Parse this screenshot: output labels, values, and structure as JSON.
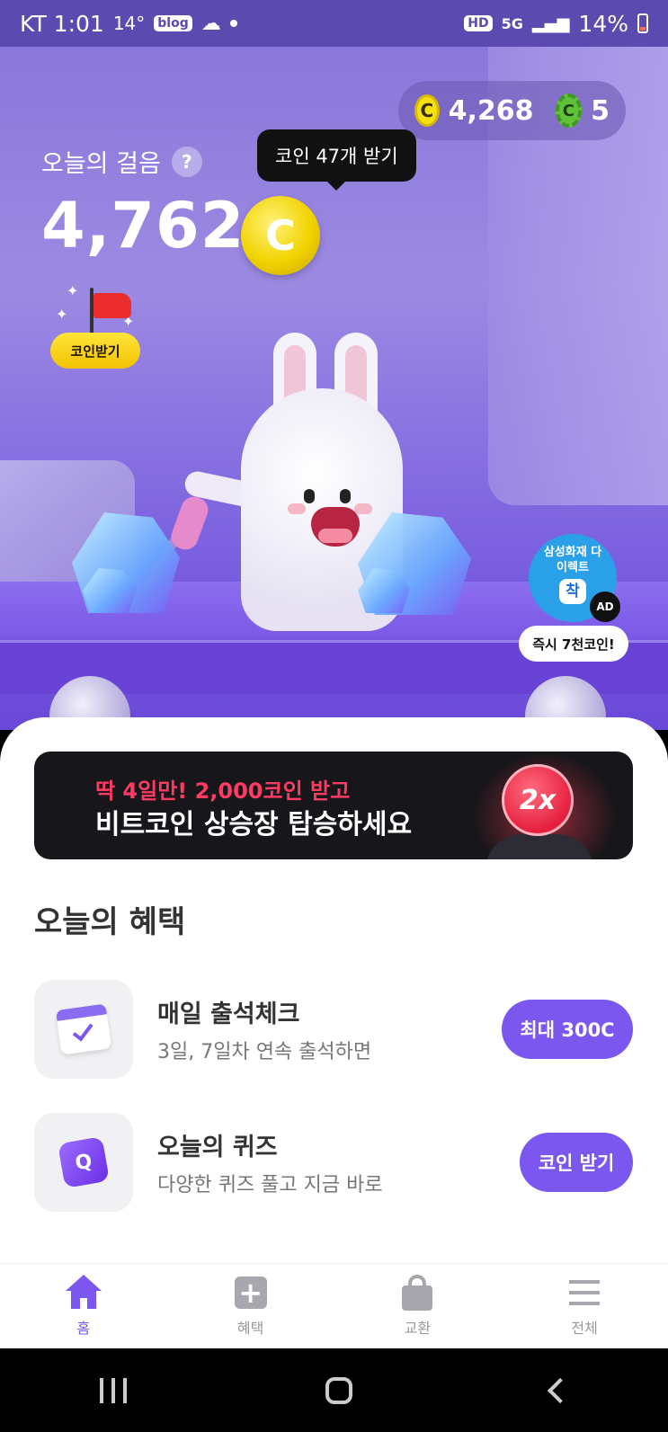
{
  "status_bar": {
    "carrier_time": "KT 1:01",
    "temp": "14°",
    "blog_badge": "blog",
    "hd": "HD",
    "net": "5G",
    "battery": "14%",
    "icons": [
      "blog-icon",
      "cloud-icon",
      "hd-icon",
      "5g-icon",
      "signal-icon",
      "battery-icon"
    ]
  },
  "hero": {
    "coin_balance": "4,268",
    "coin_symbol": "C",
    "gear_coin_count": "5",
    "steps_label": "오늘의 걸음",
    "help_symbol": "?",
    "steps_value": "4,762",
    "tooltip": "코인 47개 받기",
    "flag_label": "코인받기",
    "ad": {
      "brand": "삼성화재 다이렉트",
      "logo_char": "착",
      "tag": "AD",
      "promo": "즉시 7천코인!"
    }
  },
  "banner": {
    "line1": "딱 4일만! 2,000코인 받고",
    "line2": "비트코인 상승장 탑승하세요",
    "coin_text": "2x"
  },
  "benefits": {
    "title": "오늘의 혜택",
    "items": [
      {
        "title": "매일 출석체크",
        "subtitle": "3일, 7일차 연속 출석하면",
        "button": "최대 300C",
        "icon": "calendar-check-icon"
      },
      {
        "title": "오늘의 퀴즈",
        "subtitle": "다양한 퀴즈 풀고 지금 바로",
        "button": "코인 받기",
        "icon": "quiz-icon",
        "icon_char": "Q"
      }
    ]
  },
  "nav": {
    "items": [
      {
        "label": "홈",
        "icon": "home-icon",
        "active": true
      },
      {
        "label": "혜택",
        "icon": "plus-box-icon",
        "active": false
      },
      {
        "label": "교환",
        "icon": "shopping-bag-icon",
        "active": false
      },
      {
        "label": "전체",
        "icon": "menu-icon",
        "active": false
      }
    ]
  },
  "colors": {
    "accent": "#7b57f0",
    "hero_bg": "#8a77db",
    "coin_yellow": "#f5e10f",
    "banner_red": "#ff3b63"
  }
}
